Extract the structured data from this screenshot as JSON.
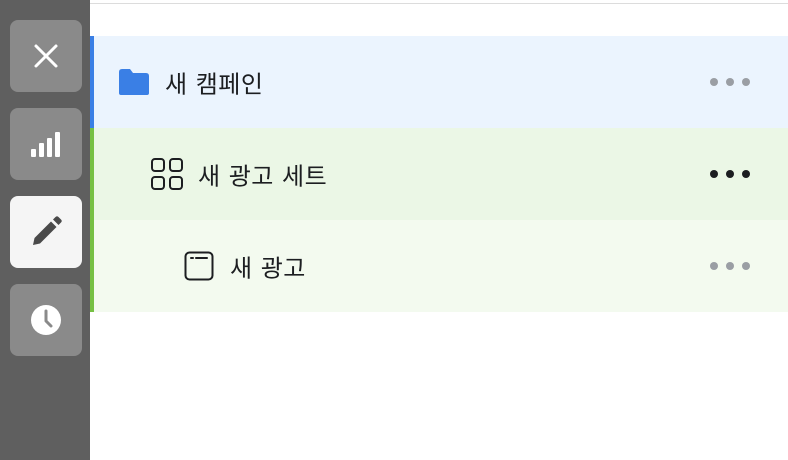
{
  "sidebar": {
    "buttons": [
      {
        "icon": "close-icon",
        "active": false
      },
      {
        "icon": "bar-chart-icon",
        "active": false
      },
      {
        "icon": "pencil-icon",
        "active": true
      },
      {
        "icon": "clock-icon",
        "active": false
      }
    ]
  },
  "tree": {
    "campaign": {
      "label": "새 캠페인",
      "icon": "folder-icon",
      "more_icon": "more-horizontal-icon"
    },
    "adset": {
      "label": "새 광고 세트",
      "icon": "grid-icon",
      "more_icon": "more-horizontal-icon"
    },
    "ad": {
      "label": "새 광고",
      "icon": "ad-frame-icon",
      "more_icon": "more-horizontal-icon"
    }
  },
  "colors": {
    "sidebar_bg": "#5f5f5f",
    "sidebar_button": "#8a8a8a",
    "sidebar_button_active": "#f5f5f5",
    "campaign_bg": "#ebf4fe",
    "campaign_accent": "#3a7fe5",
    "adset_bg": "#ebf7e6",
    "ad_bg": "#f3faef",
    "adset_accent": "#76c043",
    "folder_blue": "#3a7fe5"
  }
}
